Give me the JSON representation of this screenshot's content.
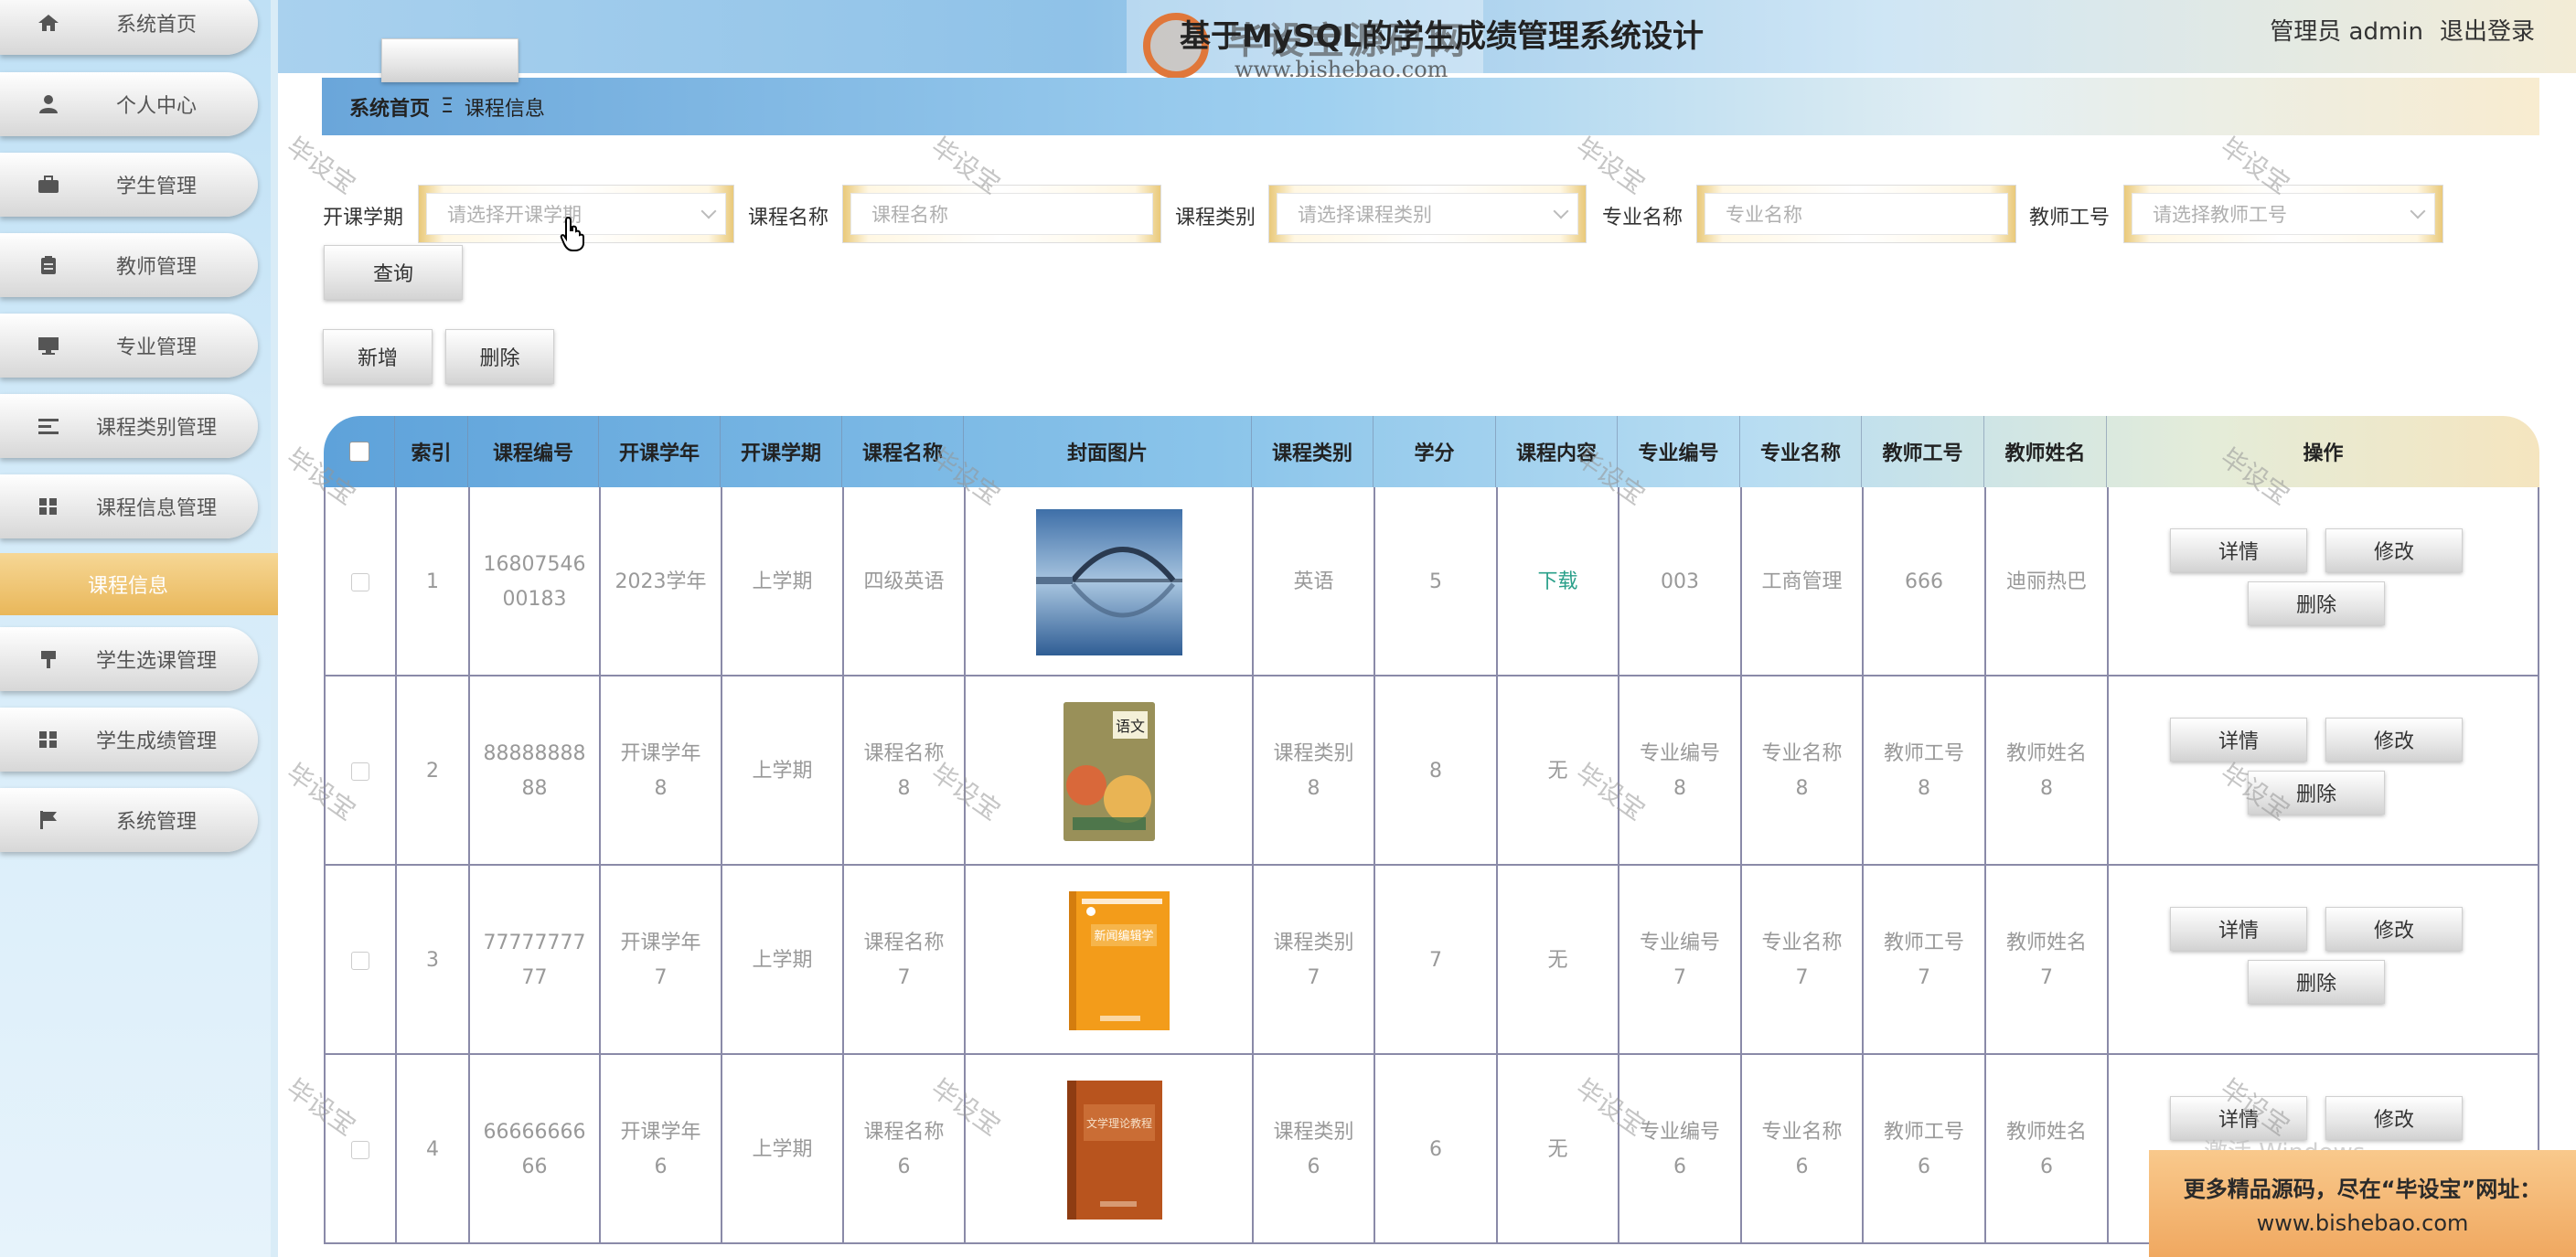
{
  "sidebar": {
    "items": [
      {
        "label": "系统首页",
        "icon": "home-icon"
      },
      {
        "label": "个人中心",
        "icon": "user-icon"
      },
      {
        "label": "学生管理",
        "icon": "briefcase-icon"
      },
      {
        "label": "教师管理",
        "icon": "clipboard-icon"
      },
      {
        "label": "专业管理",
        "icon": "monitor-icon"
      },
      {
        "label": "课程类别管理",
        "icon": "list-icon"
      },
      {
        "label": "课程信息管理",
        "icon": "grid-icon"
      },
      {
        "label": "学生选课管理",
        "icon": "pin-icon"
      },
      {
        "label": "学生成绩管理",
        "icon": "grid-icon"
      },
      {
        "label": "系统管理",
        "icon": "flag-icon"
      }
    ],
    "sub_active": "课程信息"
  },
  "header": {
    "title": "基于MySQL的学生成绩管理系统设计",
    "user": "管理员 admin",
    "logout": "退出登录",
    "watermark_logo_title": "毕设宝源码网",
    "watermark_logo_url": "www.bishebao.com"
  },
  "breadcrumb": {
    "home": "系统首页",
    "sep": "Ξ",
    "current": "课程信息"
  },
  "search": {
    "term_label": "开课学期",
    "term_placeholder": "请选择开课学期",
    "name_label": "课程名称",
    "name_placeholder": "课程名称",
    "type_label": "课程类别",
    "type_placeholder": "请选择课程类别",
    "major_label": "专业名称",
    "major_placeholder": "专业名称",
    "teacher_label": "教师工号",
    "teacher_placeholder": "请选择教师工号",
    "query_button": "查询"
  },
  "actions": {
    "add": "新增",
    "delete": "删除"
  },
  "table": {
    "headers": [
      "索引",
      "课程编号",
      "开课学年",
      "开课学期",
      "课程名称",
      "封面图片",
      "课程类别",
      "学分",
      "课程内容",
      "专业编号",
      "专业名称",
      "教师工号",
      "教师姓名",
      "操作"
    ],
    "ops": {
      "detail": "详情",
      "edit": "修改",
      "delete": "删除"
    },
    "rows": [
      {
        "index": "1",
        "course_no_1": "16807546",
        "course_no_2": "00183",
        "year_1": "2023学年",
        "year_2": "",
        "term": "上学期",
        "name_1": "四级英语",
        "name_2": "",
        "cover": "bridge-photo",
        "type_1": "英语",
        "type_2": "",
        "credit": "5",
        "content": "下载",
        "major_no_1": "003",
        "major_no_2": "",
        "major_1": "工商管理",
        "major_2": "",
        "teacher_no_1": "666",
        "teacher_no_2": "",
        "teacher_1": "迪丽热巴",
        "teacher_2": ""
      },
      {
        "index": "2",
        "course_no_1": "88888888",
        "course_no_2": "88",
        "year_1": "开课学年",
        "year_2": "8",
        "term": "上学期",
        "name_1": "课程名称",
        "name_2": "8",
        "cover": "chinese-textbook",
        "type_1": "课程类别",
        "type_2": "8",
        "credit": "8",
        "content": "无",
        "major_no_1": "专业编号",
        "major_no_2": "8",
        "major_1": "专业名称",
        "major_2": "8",
        "teacher_no_1": "教师工号",
        "teacher_no_2": "8",
        "teacher_1": "教师姓名",
        "teacher_2": "8"
      },
      {
        "index": "3",
        "course_no_1": "77777777",
        "course_no_2": "77",
        "year_1": "开课学年",
        "year_2": "7",
        "term": "上学期",
        "name_1": "课程名称",
        "name_2": "7",
        "cover": "journalism-book",
        "type_1": "课程类别",
        "type_2": "7",
        "credit": "7",
        "content": "无",
        "major_no_1": "专业编号",
        "major_no_2": "7",
        "major_1": "专业名称",
        "major_2": "7",
        "teacher_no_1": "教师工号",
        "teacher_no_2": "7",
        "teacher_1": "教师姓名",
        "teacher_2": "7"
      },
      {
        "index": "4",
        "course_no_1": "66666666",
        "course_no_2": "66",
        "year_1": "开课学年",
        "year_2": "6",
        "term": "上学期",
        "name_1": "课程名称",
        "name_2": "6",
        "cover": "literature-book",
        "type_1": "课程类别",
        "type_2": "6",
        "credit": "6",
        "content": "无",
        "major_no_1": "专业编号",
        "major_no_2": "6",
        "major_1": "专业名称",
        "major_2": "6",
        "teacher_no_1": "教师工号",
        "teacher_no_2": "6",
        "teacher_1": "教师姓名",
        "teacher_2": "6"
      }
    ]
  },
  "watermark_text": "毕设宝",
  "promo": {
    "line1": "更多精品源码，尽在“毕设宝”网址：",
    "line2": "www.bishebao.com"
  },
  "os_watermark": "激活 Windows",
  "colors": {
    "header_blue": "#8fc2e8",
    "active_gold": "#e9b75a",
    "download_green": "#2aa08a"
  }
}
